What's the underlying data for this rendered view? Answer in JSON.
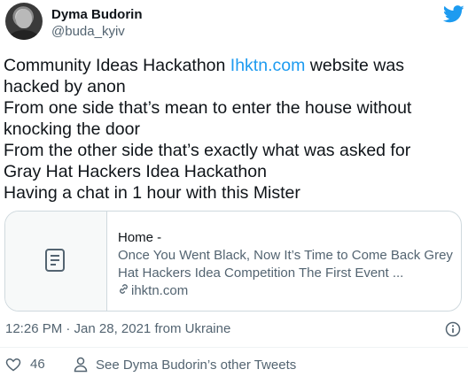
{
  "author": {
    "name": "Dyma Budorin",
    "handle": "@buda_kyiv"
  },
  "tweet": {
    "line1_before": "Community Ideas Hackathon ",
    "line1_link": "Ihktn.com",
    "line1_after": " website was hacked by anon",
    "line2": "From one side that’s mean to enter the house without knocking the door",
    "line3": "From the other side that’s exactly what was asked for",
    "line4": "Gray Hat Hackers Idea Hackathon",
    "line5": "Having a chat in 1 hour with this Mister"
  },
  "card": {
    "title": "Home -",
    "description": "Once You Went Black, Now It’s Time to Come Back Grey Hat Hackers Idea Competition The First Event ...",
    "domain": "ihktn.com",
    "thumb_icon": "document-icon"
  },
  "meta": {
    "timestamp": "12:26 PM · Jan 28, 2021 from Ukraine"
  },
  "actions": {
    "likes": "46",
    "other_tweets": "See Dyma Budorin’s other Tweets"
  },
  "colors": {
    "link": "#1d9bf0",
    "muted": "#536471",
    "text": "#0f1419",
    "border": "#cfd9de"
  }
}
